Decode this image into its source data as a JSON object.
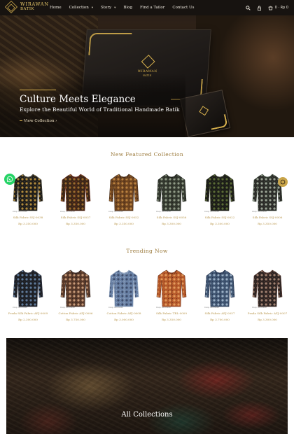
{
  "brand": {
    "name_line1": "WIRAWAN",
    "name_line2": "BATIK"
  },
  "nav": {
    "items": [
      {
        "label": "Home",
        "has_caret": false
      },
      {
        "label": "Collection",
        "has_caret": true
      },
      {
        "label": "Story",
        "has_caret": true
      },
      {
        "label": "Blog",
        "has_caret": false
      },
      {
        "label": "Find a Tailor",
        "has_caret": false
      },
      {
        "label": "Contact Us",
        "has_caret": false
      }
    ],
    "cart_text": "0 · Rp 0",
    "icons": [
      "search-icon",
      "lock-icon",
      "cart-icon"
    ]
  },
  "hero": {
    "title": "Culture Meets Elegance",
    "subtitle": "Explore the Beautiful World of Traditional Handmade Batik",
    "cta": "View Collection",
    "box_brand_line1": "WIRAWAN",
    "box_brand_line2": "BATIK"
  },
  "featured": {
    "title": "New Featured Collection",
    "products": [
      {
        "name": "Silk Fabric SSJ-0038",
        "price": "Rp 3.350.000",
        "tag": "Coop. sold tailor",
        "colors": [
          "#1f1d19",
          "#b08a3c",
          "#4c4a3e"
        ]
      },
      {
        "name": "Silk Fabric SSJ-0037",
        "price": "Rp 3.350.000",
        "tag": "Coop. sold tailor",
        "colors": [
          "#3b2617",
          "#9a6a2d",
          "#6b2b1e"
        ]
      },
      {
        "name": "Silk Fabric SSJ-0052",
        "price": "Rp 3.350.000",
        "tag": "Coop. sold tailor",
        "colors": [
          "#6e4420",
          "#b9803e",
          "#3e2614"
        ]
      },
      {
        "name": "Silk Fabric SSJ-0056",
        "price": "Rp 3.300.000",
        "tag": "Coop. sold tailor",
        "colors": [
          "#34392f",
          "#8f9a86",
          "#1f221c"
        ]
      },
      {
        "name": "Silk Fabric SSJ-0022",
        "price": "Rp 3.300.000",
        "tag": "Coop. sold tailor",
        "colors": [
          "#1c1d18",
          "#5a6a35",
          "#313428"
        ]
      },
      {
        "name": "Silk Fabric SSJ-0006",
        "price": "Rp 3.350.000",
        "tag": "Coop. sold tailor",
        "colors": [
          "#2b2b28",
          "#9aa394",
          "#3d4a3b"
        ]
      }
    ]
  },
  "trending": {
    "title": "Trending Now",
    "products": [
      {
        "name": "Prada Silk Fabric AFJ-0009",
        "price": "Rp 2.300.000",
        "tag": "Coop. sold tailor",
        "colors": [
          "#1d1f24",
          "#5f7a9a",
          "#2c3140"
        ]
      },
      {
        "name": "Cotton Fabric AFJ-0006",
        "price": "Rp 3.750.000",
        "tag": "Coop. sold tailor",
        "colors": [
          "#5a3a2a",
          "#c79a78",
          "#2e2320"
        ]
      },
      {
        "name": "Cotton Fabric AFJ-0008",
        "price": "Rp 3.000.000",
        "tag": "Coop. sold tailor",
        "colors": [
          "#6a82a6",
          "#3e4d6b",
          "#9fb1c8"
        ]
      },
      {
        "name": "Silk Fabric TRL-0009",
        "price": "Rp 3.350.000",
        "tag": "Coop. sold tailor",
        "colors": [
          "#b5592a",
          "#e29a5c",
          "#6b2e18"
        ]
      },
      {
        "name": "Silk Fabric AFJ-0057",
        "price": "Rp 3.700.000",
        "tag": "Coop. sold tailor",
        "colors": [
          "#3f5470",
          "#9bb0c6",
          "#23304a"
        ]
      },
      {
        "name": "Prada Silk Fabric AFJ-0007",
        "price": "Rp 3.300.000",
        "tag": "Coop. sold tailor",
        "colors": [
          "#2d2422",
          "#a08070",
          "#5a3b33"
        ]
      }
    ]
  },
  "collections_banner": {
    "title": "All Collections"
  },
  "colors": {
    "gold": "#b9974e",
    "nav_bg": "#171310",
    "whatsapp": "#25d366"
  }
}
